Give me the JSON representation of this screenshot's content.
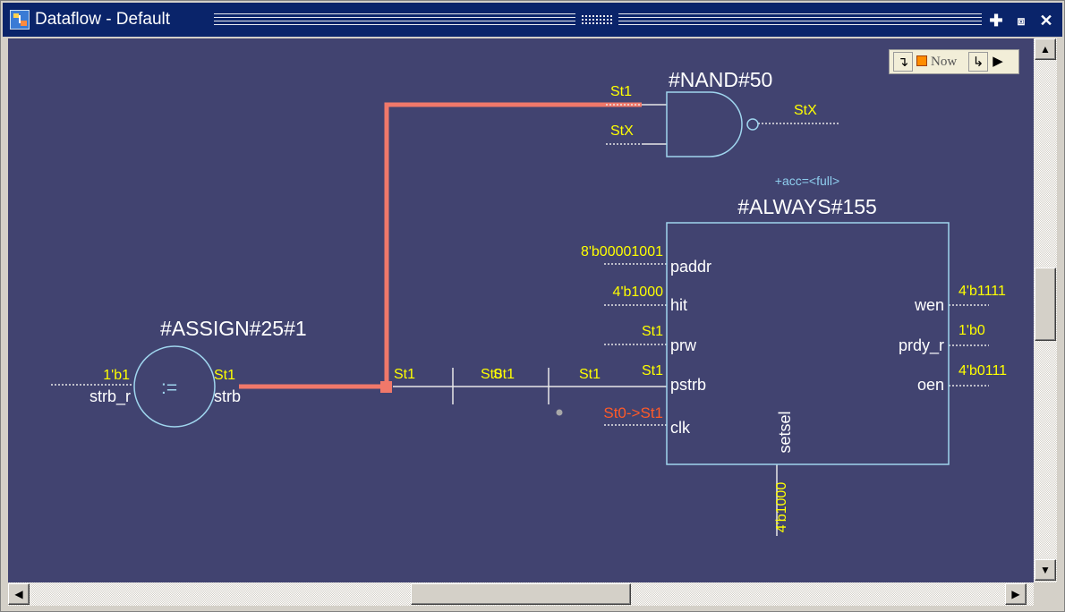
{
  "window": {
    "title": "Dataflow - Default",
    "controls": [
      "maximize",
      "undock",
      "close"
    ]
  },
  "toolbar": {
    "back_icon": "trace-back-icon",
    "now_label": "Now",
    "forward_icon": "trace-forward-icon",
    "play_icon": "play-icon"
  },
  "colors": {
    "canvas_bg": "#414370",
    "value_text": "#ffff00",
    "block_outline": "#9fd5ee",
    "highlight_wire": "#f0786a",
    "event_text": "#ff5a28",
    "title_bar": "#0a246a"
  },
  "nand": {
    "name": "#NAND#50",
    "in1_value": "St1",
    "in2_value": "StX",
    "out_value": "StX"
  },
  "assign": {
    "name": "#ASSIGN#25#1",
    "operator": ":=",
    "in_value": "1'b1",
    "in_port": "strb_r",
    "out_value": "St1",
    "out_port": "strb"
  },
  "wire_labels": {
    "st1_a": "St1",
    "st1_b": "St1",
    "st1_c": "St1",
    "st0_overlap": "St0"
  },
  "always": {
    "annotation": "+acc=<full>",
    "name": "#ALWAYS#155",
    "inputs": [
      {
        "port": "paddr",
        "value": "8'b00001001"
      },
      {
        "port": "hit",
        "value": "4'b1000"
      },
      {
        "port": "prw",
        "value": "St1"
      },
      {
        "port": "pstrb",
        "value": "St1"
      },
      {
        "port": "clk",
        "value": "St0->St1"
      }
    ],
    "outputs": [
      {
        "port": "wen",
        "value": "4'b1111"
      },
      {
        "port": "prdy_r",
        "value": "1'b0"
      },
      {
        "port": "oen",
        "value": "4'b0111"
      }
    ],
    "bottom_port": {
      "port": "setsel",
      "value": "4'b1000"
    }
  }
}
